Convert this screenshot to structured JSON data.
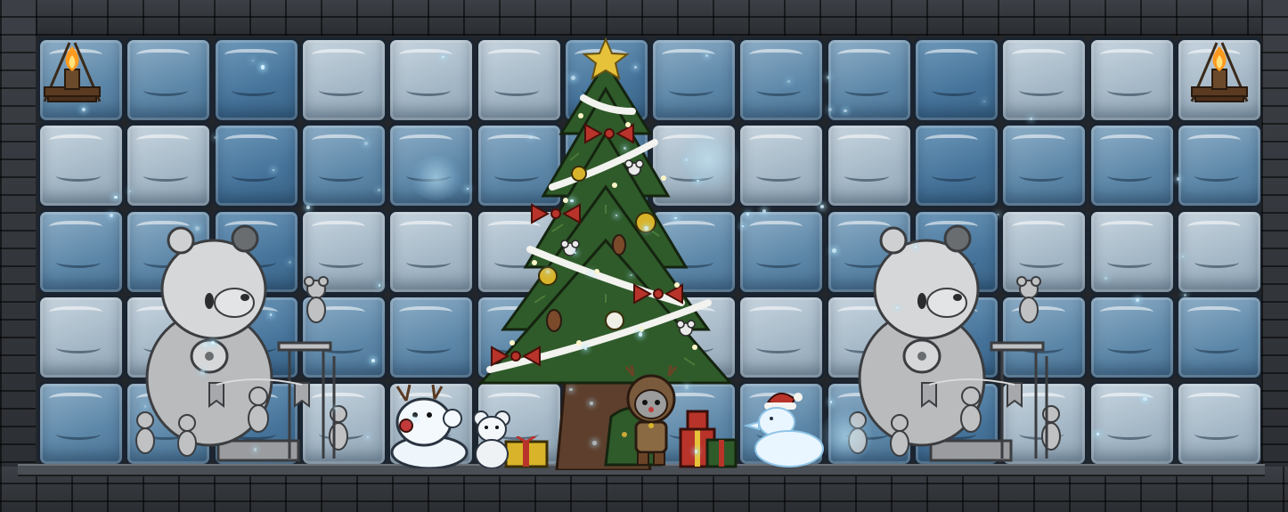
{
  "scene": {
    "name": "winter-festival-room",
    "wall_material": "ice-blocks",
    "frame_material": "dark-stone-bricks"
  },
  "objects": {
    "torch_left": {
      "icon": "wall-torch-icon"
    },
    "torch_right": {
      "icon": "wall-torch-icon"
    },
    "tree": {
      "icon": "christmas-tree-icon",
      "topper": "star"
    },
    "bear_statue_left": {
      "icon": "bear-statue-icon"
    },
    "bear_statue_right": {
      "icon": "bear-statue-icon"
    },
    "snowman_reindeer": {
      "icon": "reindeer-snowman-icon"
    },
    "snow_mouse": {
      "icon": "snow-mouse-icon"
    },
    "snow_duck": {
      "icon": "santa-hat-snow-duck-icon"
    },
    "player_mouse": {
      "icon": "reindeer-hood-mouse-icon"
    },
    "gift_left": {
      "icon": "gift-box-icon"
    },
    "gift_right": {
      "icon": "gift-box-icon"
    },
    "sack": {
      "icon": "gift-sack-icon"
    }
  },
  "colors": {
    "ice_light": "#c8d6e0",
    "ice_mid": "#8fb0c9",
    "ice_dark": "#46739a",
    "stone": "#2c2f33",
    "tree_green": "#2f5a2a",
    "bow_red": "#b8342a",
    "star_gold": "#e6c23a",
    "flame": "#ff9a1f"
  }
}
